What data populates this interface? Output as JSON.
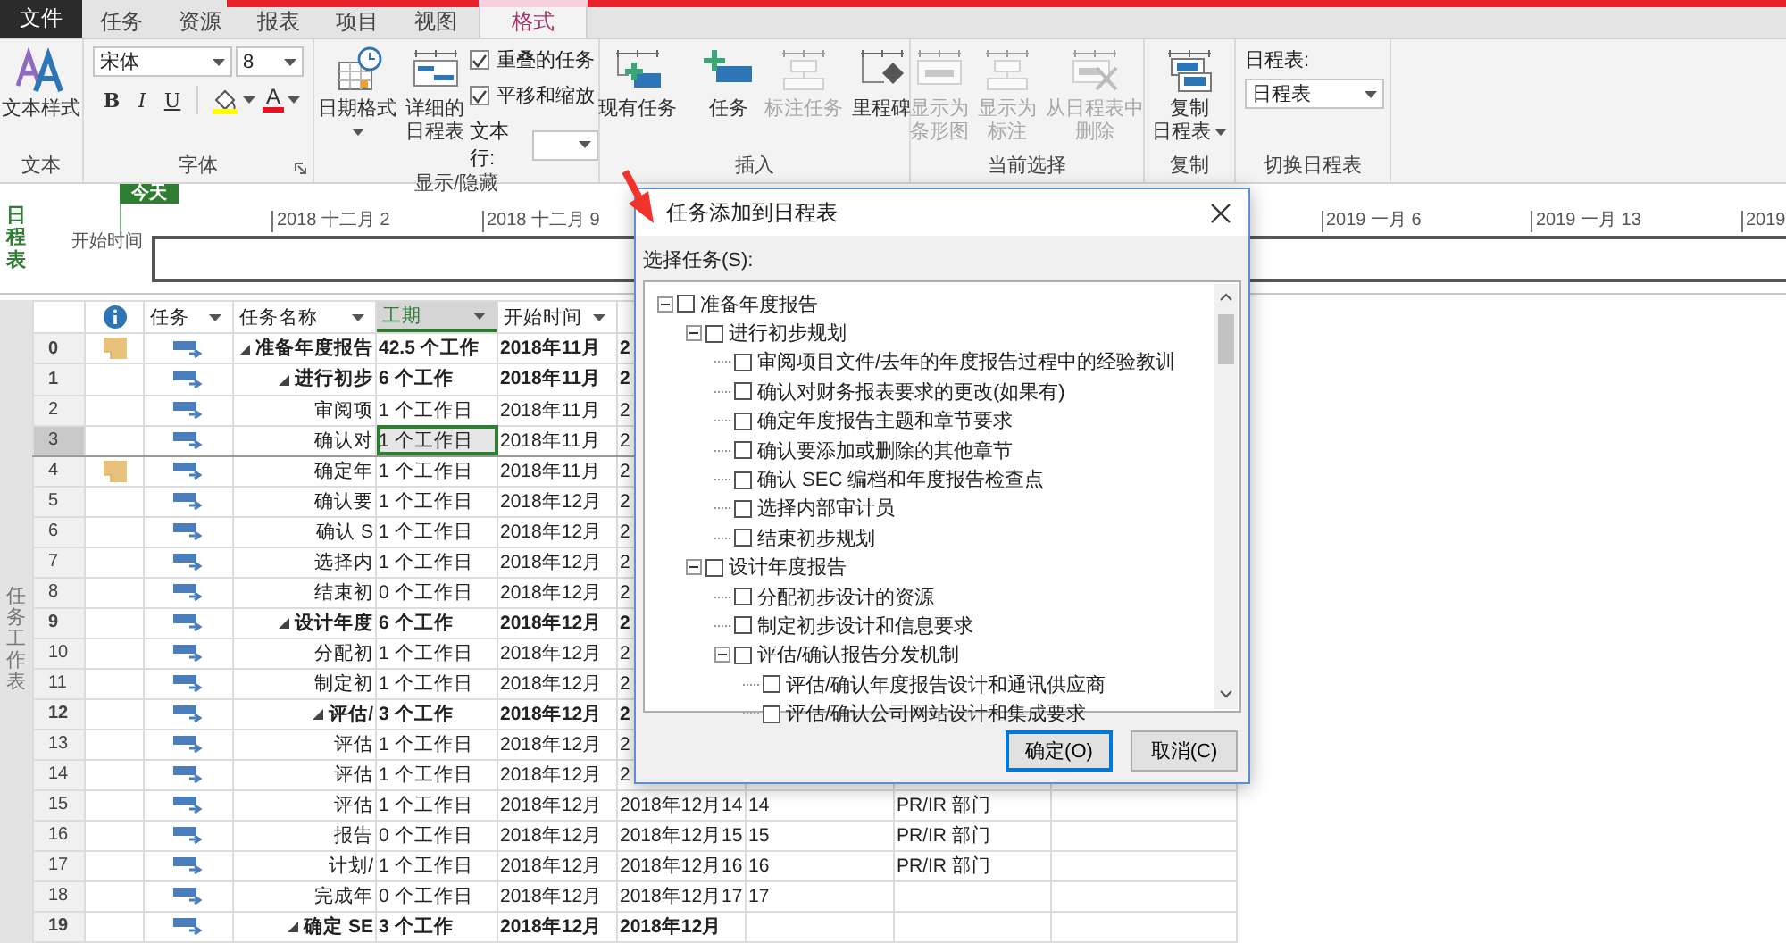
{
  "tabs": [
    {
      "label": "文件",
      "kind": "file",
      "selected": false
    },
    {
      "label": "任务",
      "kind": "tab",
      "selected": false
    },
    {
      "label": "资源",
      "kind": "tab",
      "selected": false
    },
    {
      "label": "报表",
      "kind": "tab",
      "selected": false
    },
    {
      "label": "项目",
      "kind": "tab",
      "selected": false
    },
    {
      "label": "视图",
      "kind": "tab",
      "selected": false
    },
    {
      "label": "格式",
      "kind": "tab",
      "selected": true
    }
  ],
  "ribbon": [
    {
      "kind": "buttons",
      "label": "文本",
      "buttons": [
        {
          "label": "文本样式",
          "dropdown": false,
          "disabled": false
        }
      ]
    },
    {
      "kind": "font",
      "label": "字体",
      "launcher": true,
      "font": "宋体",
      "size": "8",
      "styles": [
        "B",
        "I",
        "U"
      ],
      "highlight": {
        "color": "#ffff00"
      },
      "font_color": {
        "label": "A",
        "color": "#e81123"
      }
    },
    {
      "kind": "display",
      "label": "显示/隐藏",
      "buttons": [
        {
          "label": "日期格式",
          "dropdown": true,
          "disabled": false
        },
        {
          "label": "详细的日程表",
          "dropdown": false,
          "disabled": false
        }
      ],
      "checkboxes": [
        {
          "label": "重叠的任务",
          "checked": true
        },
        {
          "label": "平移和缩放",
          "checked": true
        }
      ],
      "text_lines_label": "文本行:"
    },
    {
      "kind": "buttons",
      "label": "插入",
      "buttons": [
        {
          "label": "现有任务",
          "dropdown": false,
          "disabled": false,
          "divider_after": true
        },
        {
          "label": "任务",
          "dropdown": false,
          "disabled": false
        },
        {
          "label": "标注任务",
          "dropdown": false,
          "disabled": true
        },
        {
          "label": "里程碑",
          "dropdown": false,
          "disabled": false
        }
      ]
    },
    {
      "kind": "buttons",
      "label": "当前选择",
      "buttons": [
        {
          "label": "显示为条形图",
          "dropdown": false,
          "disabled": true
        },
        {
          "label": "显示为标注",
          "dropdown": false,
          "disabled": true
        },
        {
          "label": "从日程表中删除",
          "dropdown": false,
          "disabled": true
        }
      ]
    },
    {
      "kind": "buttons",
      "label": "复制",
      "buttons": [
        {
          "label": "复制日程表",
          "dropdown": true,
          "disabled": false
        }
      ]
    },
    {
      "kind": "switch",
      "label": "切换日程表",
      "field_label": "日程表:",
      "value": "日程表"
    }
  ],
  "timeline": {
    "side_label": "日程表",
    "today": "今天",
    "start_label": "开始时间",
    "ticks": [
      "2018 十二月 2",
      "2018 十二月 9",
      "2019 一月 6",
      "2019 一月 13",
      "2019"
    ]
  },
  "sheet": {
    "side_label": "任务工作表",
    "columns": [
      {
        "kind": "info"
      },
      {
        "kind": "text",
        "label": "任务",
        "filter": true,
        "selected": false
      },
      {
        "kind": "text",
        "label": "任务名称",
        "filter": true,
        "selected": false
      },
      {
        "kind": "text",
        "label": "工期",
        "filter": true,
        "selected": true
      },
      {
        "kind": "text",
        "label": "开始时间",
        "filter": true,
        "selected": false
      }
    ],
    "rows": [
      {
        "id": "0",
        "note": true,
        "summary": true,
        "expanded": true,
        "name": "准备年度报告",
        "duration": "42.5 个工作",
        "start": "2018年11月",
        "finish": "2",
        "selected": false
      },
      {
        "id": "1",
        "note": false,
        "summary": true,
        "expanded": true,
        "name": "进行初步",
        "duration": "6 个工作",
        "start": "2018年11月",
        "finish": "2",
        "selected": false
      },
      {
        "id": "2",
        "note": false,
        "summary": false,
        "name": "审阅项",
        "duration": "1 个工作日",
        "start": "2018年11月",
        "finish": "2",
        "selected": false
      },
      {
        "id": "3",
        "note": false,
        "summary": false,
        "name": "确认对",
        "duration": "1 个工作日",
        "start": "2018年11月",
        "finish": "2",
        "selected": true
      },
      {
        "id": "4",
        "note": true,
        "summary": false,
        "name": "确定年",
        "duration": "1 个工作日",
        "start": "2018年11月",
        "finish": "2",
        "selected": false
      },
      {
        "id": "5",
        "note": false,
        "summary": false,
        "name": "确认要",
        "duration": "1 个工作日",
        "start": "2018年12月",
        "finish": "2",
        "selected": false
      },
      {
        "id": "6",
        "note": false,
        "summary": false,
        "name": "确认 S",
        "duration": "1 个工作日",
        "start": "2018年12月",
        "finish": "2",
        "selected": false
      },
      {
        "id": "7",
        "note": false,
        "summary": false,
        "name": "选择内",
        "duration": "1 个工作日",
        "start": "2018年12月",
        "finish": "2",
        "selected": false
      },
      {
        "id": "8",
        "note": false,
        "summary": false,
        "name": "结束初",
        "duration": "0 个工作日",
        "start": "2018年12月",
        "finish": "2",
        "selected": false
      },
      {
        "id": "9",
        "note": false,
        "summary": true,
        "expanded": true,
        "name": "设计年度",
        "duration": "6 个工作",
        "start": "2018年12月",
        "finish": "2",
        "selected": false
      },
      {
        "id": "10",
        "note": false,
        "summary": false,
        "name": "分配初",
        "duration": "1 个工作日",
        "start": "2018年12月",
        "finish": "2",
        "selected": false
      },
      {
        "id": "11",
        "note": false,
        "summary": false,
        "name": "制定初",
        "duration": "1 个工作日",
        "start": "2018年12月",
        "finish": "2",
        "selected": false
      },
      {
        "id": "12",
        "note": false,
        "summary": true,
        "expanded": true,
        "name": "评估/",
        "duration": "3 个工作",
        "start": "2018年12月",
        "finish": "2",
        "selected": false
      },
      {
        "id": "13",
        "note": false,
        "summary": false,
        "name": "评估",
        "duration": "1 个工作日",
        "start": "2018年12月",
        "finish": "2",
        "selected": false
      },
      {
        "id": "14",
        "note": false,
        "summary": false,
        "name": "评估",
        "duration": "1 个工作日",
        "start": "2018年12月",
        "finish": "2",
        "selected": false
      },
      {
        "id": "15",
        "note": false,
        "summary": false,
        "name": "评估",
        "duration": "1 个工作日",
        "start": "2018年12月",
        "finish": "2018年12月14",
        "predecessors": "14",
        "resources": "PR/IR 部门",
        "selected": false
      },
      {
        "id": "16",
        "note": false,
        "summary": false,
        "name": "报告",
        "duration": "0 个工作日",
        "start": "2018年12月",
        "finish": "2018年12月15",
        "predecessors": "15",
        "resources": "PR/IR 部门",
        "selected": false
      },
      {
        "id": "17",
        "note": false,
        "summary": false,
        "name": "计划/",
        "duration": "1 个工作日",
        "start": "2018年12月",
        "finish": "2018年12月16",
        "predecessors": "16",
        "resources": "PR/IR 部门",
        "selected": false
      },
      {
        "id": "18",
        "note": false,
        "summary": false,
        "name": "完成年",
        "duration": "0 个工作日",
        "start": "2018年12月",
        "finish": "2018年12月17",
        "predecessors": "17",
        "selected": false
      },
      {
        "id": "19",
        "note": false,
        "summary": true,
        "expanded": true,
        "name": "确定 SE",
        "duration": "3 个工作",
        "start": "2018年12月",
        "finish": "2018年12月",
        "selected": false
      }
    ]
  },
  "dialog": {
    "title": "任务添加到日程表",
    "label": "选择任务(S):",
    "tasks": [
      {
        "label": "准备年度报告",
        "checked": false,
        "expanded": true,
        "children": [
          {
            "label": "进行初步规划",
            "checked": false,
            "expanded": true,
            "children": [
              {
                "label": "审阅项目文件/去年的年度报告过程中的经验教训",
                "checked": false
              },
              {
                "label": "确认对财务报表要求的更改(如果有)",
                "checked": false
              },
              {
                "label": "确定年度报告主题和章节要求",
                "checked": false
              },
              {
                "label": "确认要添加或删除的其他章节",
                "checked": false
              },
              {
                "label": "确认 SEC 编档和年度报告检查点",
                "checked": false
              },
              {
                "label": "选择内部审计员",
                "checked": false
              },
              {
                "label": "结束初步规划",
                "checked": false
              }
            ]
          },
          {
            "label": "设计年度报告",
            "checked": false,
            "expanded": true,
            "children": [
              {
                "label": "分配初步设计的资源",
                "checked": false
              },
              {
                "label": "制定初步设计和信息要求",
                "checked": false
              },
              {
                "label": "评估/确认报告分发机制",
                "checked": false,
                "expanded": true,
                "children": [
                  {
                    "label": "评估/确认年度报告设计和通讯供应商",
                    "checked": false
                  },
                  {
                    "label": "评估/确认公司网站设计和集成要求",
                    "checked": false
                  }
                ]
              }
            ]
          }
        ]
      }
    ],
    "buttons": [
      {
        "label": "确定(O)",
        "default": true
      },
      {
        "label": "取消(C)",
        "default": false
      }
    ]
  }
}
